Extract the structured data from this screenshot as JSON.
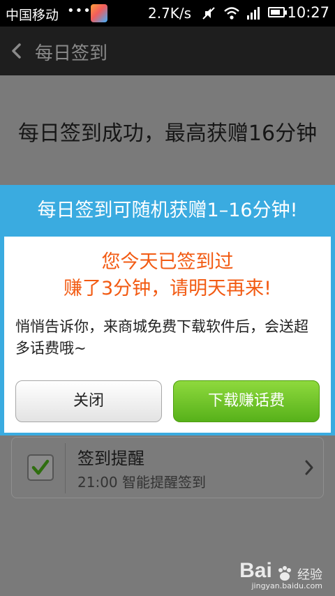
{
  "status_bar": {
    "carrier": "中国移动",
    "dots": "•••",
    "net_speed": "2.7K/s",
    "time": "10:27",
    "battery_level": 0.8,
    "icons": [
      "app-store-icon",
      "mute-icon",
      "wifi-icon",
      "signal-icon",
      "battery-icon"
    ]
  },
  "title_bar": {
    "title": "每日签到"
  },
  "background": {
    "message": "每日签到成功，最高获赠16分钟",
    "reminder": {
      "title": "签到提醒",
      "subtitle": "21:00 智能提醒签到",
      "checked": true
    }
  },
  "dialog": {
    "header": "每日签到可随机获赠1–16分钟!",
    "headline_line1": "您今天已签到过",
    "headline_line2": "赚了3分钟，请明天再来!",
    "body": "悄悄告诉你，来商城免费下载软件后，会送超多话费哦~",
    "close_label": "关闭",
    "download_label": "下载赚话费"
  },
  "watermark": {
    "logo": "Bai",
    "text": "经验",
    "url": "jingyan.baidu.com"
  },
  "colors": {
    "dialog_blue": "#3aabe0",
    "headline_orange": "#f25a12",
    "download_green": "#57b11a"
  }
}
